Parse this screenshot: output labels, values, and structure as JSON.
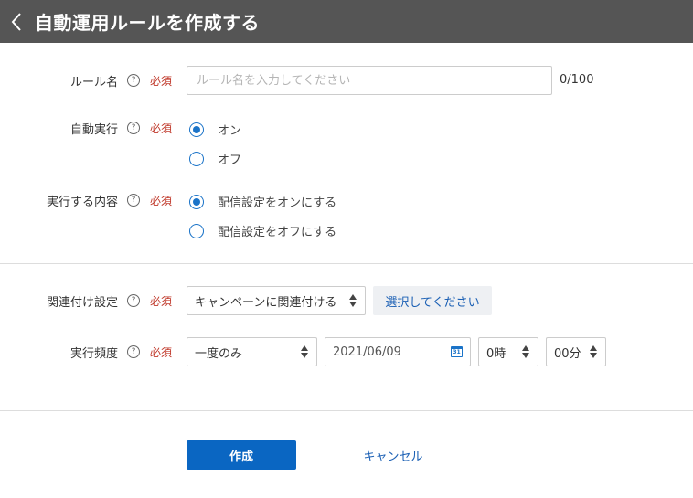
{
  "header": {
    "title": "自動運用ルールを作成する"
  },
  "required_text": "必須",
  "help_glyph": "?",
  "fields": {
    "rule_name": {
      "label": "ルール名",
      "placeholder": "ルール名を入力してください",
      "value": "",
      "counter": "0/100"
    },
    "auto_execute": {
      "label": "自動実行",
      "options": [
        {
          "label": "オン",
          "checked": true
        },
        {
          "label": "オフ",
          "checked": false
        }
      ]
    },
    "action": {
      "label": "実行する内容",
      "options": [
        {
          "label": "配信設定をオンにする",
          "checked": true
        },
        {
          "label": "配信設定をオフにする",
          "checked": false
        }
      ]
    },
    "association": {
      "label": "関連付け設定",
      "selected": "キャンペーンに関連付ける",
      "choose_button": "選択してください"
    },
    "frequency": {
      "label": "実行頻度",
      "selected": "一度のみ",
      "date": "2021/06/09",
      "calendar_glyph": "31",
      "hour": "0時",
      "minute": "00分"
    }
  },
  "footer": {
    "submit_label": "作成",
    "cancel_label": "キャンセル"
  },
  "colors": {
    "header_bg": "#555555",
    "accent": "#0a66c2",
    "required": "#c0392b",
    "link": "#1a5fb4"
  }
}
